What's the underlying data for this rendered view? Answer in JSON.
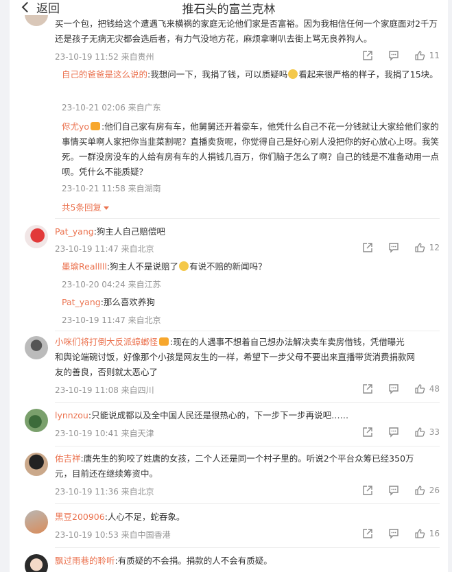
{
  "header": {
    "back_label": "返回",
    "title": "推石头的富兰克林"
  },
  "comment0": {
    "text": "买一个包，把钱给这个遭遇飞来横祸的家庭无论他们家是否富裕。因为我相信任何一个家庭面对2千万还是孩子无病无灾都会选后者，有力气没地方花，麻烦拿喇叭去街上骂无良养狗人。",
    "meta": "23-10-19 11:52 来自贵州",
    "likes": "11",
    "replies": [
      {
        "nick": "自己的爸爸是这么说的",
        "text1": ":我想问一下，我捐了钱，可以质疑吗",
        "text2": "看起来很严格的样子，我捐了15块。",
        "meta": "23-10-21 02:06 来自广东"
      },
      {
        "nick": "侭尤yo",
        "text": ":他们自己家有房有车，他舅舅还开着豪车，他凭什么自己不花一分钱就让大家给他们家的事情买单啊人家把你当韭菜割呢？直播卖货呢，你觉得自己是好心别人没把你的好心放心上呀。我笑死。一群没房没车的人给有房有车的人捐钱几百万，你们脑子怎么了啊？自己的钱是不准备动用一点呗。凭什么不能质疑？",
        "meta": "23-10-21 11:58 来自湖南"
      }
    ],
    "more_label": "共5条回复"
  },
  "comment1": {
    "nick": "Pat_yang",
    "text": ":狗主人自己赔偿吧",
    "meta": "23-10-19 11:47 来自北京",
    "likes": "12",
    "replies": [
      {
        "nick": "墨瑜Realllll",
        "text1": ":狗主人不是说赔了",
        "text2": "有说不赔的新闻吗？",
        "meta": "23-10-20 04:24 来自江苏"
      },
      {
        "nick": "Pat_yang",
        "text": ":那么喜欢养狗",
        "meta": "23-10-19 11:47 来自北京"
      }
    ]
  },
  "comment2": {
    "nick": "小咪们将打倒大反派蟑螂怪",
    "text1": ":现在的人遇事不想着自己想办法解决卖车卖房借钱，凭借曝光",
    "text2": "和舆论端碗讨饭，好像那个小孩是网友生的一样，希望下一步父母不要出来直播带货消费捐款网",
    "text3": "友的善良，否则就太恶心了",
    "meta": "23-10-19 11:08 来自四川",
    "likes": "48"
  },
  "comment3": {
    "nick": "lynnzou",
    "text": ":只能说成都以及全中国人民还是很热心的，下一步下一步再说吧……",
    "meta": "23-10-19 10:41 来自天津",
    "likes": "33"
  },
  "comment4": {
    "nick": "佑吉祥",
    "text1": ":唐先生的狗咬了姓唐的女孩，二个人还是同一个村子里的。听说2个平台众筹已经350万",
    "text2": "元，目前还在继续筹资中。",
    "meta": "23-10-19 11:36 来自北京",
    "likes": "26"
  },
  "comment5": {
    "nick": "黑豆200906",
    "text": ":人心不足，蛇吞象。",
    "meta": "23-10-19 10:53 来自中国香港",
    "likes": "16"
  },
  "comment6": {
    "nick": "飘过雨巷的聆听",
    "text": ":有质疑的不会捐。捐款的人不会有质疑。"
  }
}
